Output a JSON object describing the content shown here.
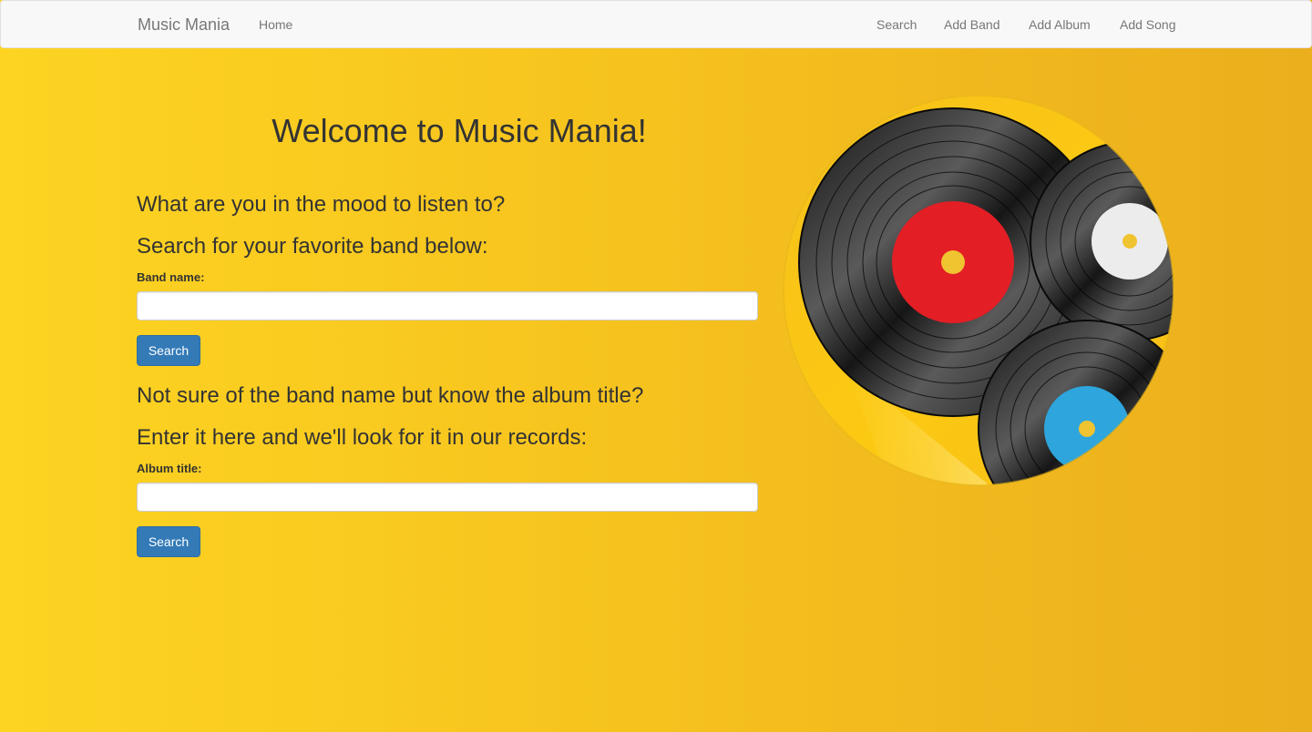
{
  "navbar": {
    "brand": "Music Mania",
    "home": "Home",
    "links": [
      "Search",
      "Add Band",
      "Add Album",
      "Add Song"
    ]
  },
  "main": {
    "title": "Welcome to Music Mania!",
    "band_section": {
      "prompt": "What are you in the mood to listen to?",
      "subprompt": "Search for your favorite band below:",
      "label": "Band name:",
      "value": "",
      "button": "Search"
    },
    "album_section": {
      "prompt": "Not sure of the band name but know the album title?",
      "subprompt": "Enter it here and we'll look for it in our records:",
      "label": "Album title:",
      "value": "",
      "button": "Search"
    }
  },
  "colors": {
    "background_left": "#fdd422",
    "background_right": "#ebae1d",
    "button_primary": "#337ab7",
    "record_label_red": "#e31e25",
    "record_label_white": "#ececec",
    "record_label_blue": "#2ea5dc",
    "record_center": "#f0c330"
  }
}
